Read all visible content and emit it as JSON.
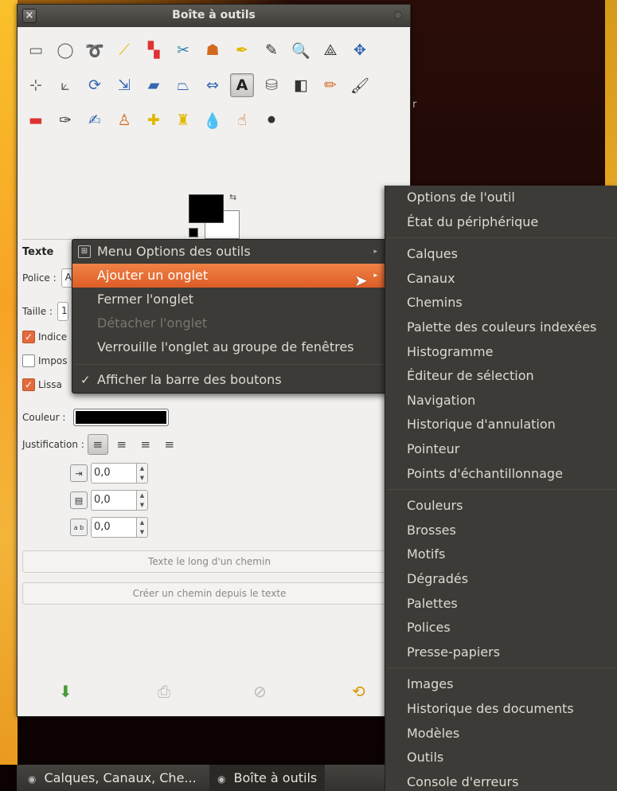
{
  "window": {
    "title": "Boîte à outils",
    "close_glyph": "×"
  },
  "background": {
    "stray_text": "r"
  },
  "tools": [
    {
      "icon": "rect-select-icon",
      "glyph": "▭",
      "color": "c-gray"
    },
    {
      "icon": "ellipse-select-icon",
      "glyph": "◯",
      "color": "c-gray"
    },
    {
      "icon": "lasso-icon",
      "glyph": "➰",
      "color": "c-gray"
    },
    {
      "icon": "fuzzy-select-icon",
      "glyph": "⟋",
      "color": "c-yellow"
    },
    {
      "icon": "color-select-icon",
      "glyph": "▚",
      "color": "c-red"
    },
    {
      "icon": "scissors-icon",
      "glyph": "✂",
      "color": "c-teal"
    },
    {
      "icon": "foreground-select-icon",
      "glyph": "☗",
      "color": "c-orange"
    },
    {
      "icon": "paths-icon",
      "glyph": "✒",
      "color": "c-yellow"
    },
    {
      "icon": "color-picker-icon",
      "glyph": "✎",
      "color": "c-dark"
    },
    {
      "icon": "zoom-icon",
      "glyph": "🔍",
      "color": "c-blue"
    },
    {
      "icon": "measure-icon",
      "glyph": "⟁",
      "color": "c-dark"
    },
    {
      "icon": "move-icon",
      "glyph": "✥",
      "color": "c-blue"
    },
    {
      "icon": "align-icon",
      "glyph": "⊹",
      "color": "c-gray"
    },
    {
      "icon": "crop-icon",
      "glyph": "⟀",
      "color": "c-gray"
    },
    {
      "icon": "rotate-icon",
      "glyph": "⟳",
      "color": "c-blue"
    },
    {
      "icon": "scale-icon",
      "glyph": "⇲",
      "color": "c-blue"
    },
    {
      "icon": "shear-icon",
      "glyph": "▰",
      "color": "c-blue"
    },
    {
      "icon": "perspective-icon",
      "glyph": "⏢",
      "color": "c-blue"
    },
    {
      "icon": "flip-icon",
      "glyph": "⇔",
      "color": "c-blue"
    },
    {
      "icon": "text-tool-icon",
      "glyph": "A",
      "color": "c-dark",
      "active": true
    },
    {
      "icon": "bucket-fill-icon",
      "glyph": "⛁",
      "color": "c-gray"
    },
    {
      "icon": "gradient-icon",
      "glyph": "◧",
      "color": "c-dark"
    },
    {
      "icon": "pencil-icon",
      "glyph": "✏",
      "color": "c-orange"
    },
    {
      "icon": "paintbrush-icon",
      "glyph": "🖌",
      "color": "c-dark"
    },
    {
      "icon": "eraser-icon",
      "glyph": "▬",
      "color": "c-red"
    },
    {
      "icon": "airbrush-icon",
      "glyph": "✑",
      "color": "c-dark"
    },
    {
      "icon": "ink-icon",
      "glyph": "✍",
      "color": "c-blue"
    },
    {
      "icon": "clone-icon",
      "glyph": "♙",
      "color": "c-orange"
    },
    {
      "icon": "heal-icon",
      "glyph": "✚",
      "color": "c-yellow"
    },
    {
      "icon": "perspective-clone-icon",
      "glyph": "♜",
      "color": "c-yellow"
    },
    {
      "icon": "blur-icon",
      "glyph": "💧",
      "color": "c-blue"
    },
    {
      "icon": "smudge-icon",
      "glyph": "☝",
      "color": "c-orange"
    },
    {
      "icon": "dodge-burn-icon",
      "glyph": "⚫",
      "color": "c-dark"
    }
  ],
  "tool_options": {
    "heading": "Texte",
    "font_label": "Police :",
    "font_value": "A",
    "size_label": "Taille :",
    "size_value": "1",
    "checkbox_1": "Indice",
    "checkbox_2": "Impos",
    "checkbox_3": "Lissa",
    "color_label": "Couleur :",
    "justify_label": "Justification :",
    "indent_value": "0,0",
    "line_spacing_value": "0,0",
    "letter_spacing_value": "0,0",
    "letter_icon_label": "a b",
    "text_along_path_button": "Texte le long d'un chemin",
    "path_from_text_button": "Créer un chemin depuis le texte"
  },
  "context_menu": {
    "items": [
      {
        "label": "Menu Options des outils",
        "arrow": "▸"
      },
      {
        "label": "Ajouter un onglet",
        "arrow": "▸"
      },
      {
        "label": "Fermer l'onglet"
      },
      {
        "label": "Détacher l'onglet"
      },
      {
        "label": "Verrouille l'onglet au groupe de fenêtres"
      },
      {
        "label": "Afficher la barre des boutons",
        "check": "✓"
      }
    ]
  },
  "submenu": {
    "groups": [
      [
        "Options de l'outil",
        "État du périphérique"
      ],
      [
        "Calques",
        "Canaux",
        "Chemins",
        "Palette des couleurs indexées",
        "Histogramme",
        "Éditeur de sélection",
        "Navigation",
        "Historique d'annulation",
        "Pointeur",
        "Points d'échantillonnage"
      ],
      [
        "Couleurs",
        "Brosses",
        "Motifs",
        "Dégradés",
        "Palettes",
        "Polices",
        "Presse-papiers"
      ],
      [
        "Images",
        "Historique des documents",
        "Modèles",
        "Outils",
        "Console d'erreurs"
      ]
    ]
  },
  "taskbar": {
    "task_1": "Calques, Canaux, Che...",
    "task_2": "Boîte à outils"
  }
}
